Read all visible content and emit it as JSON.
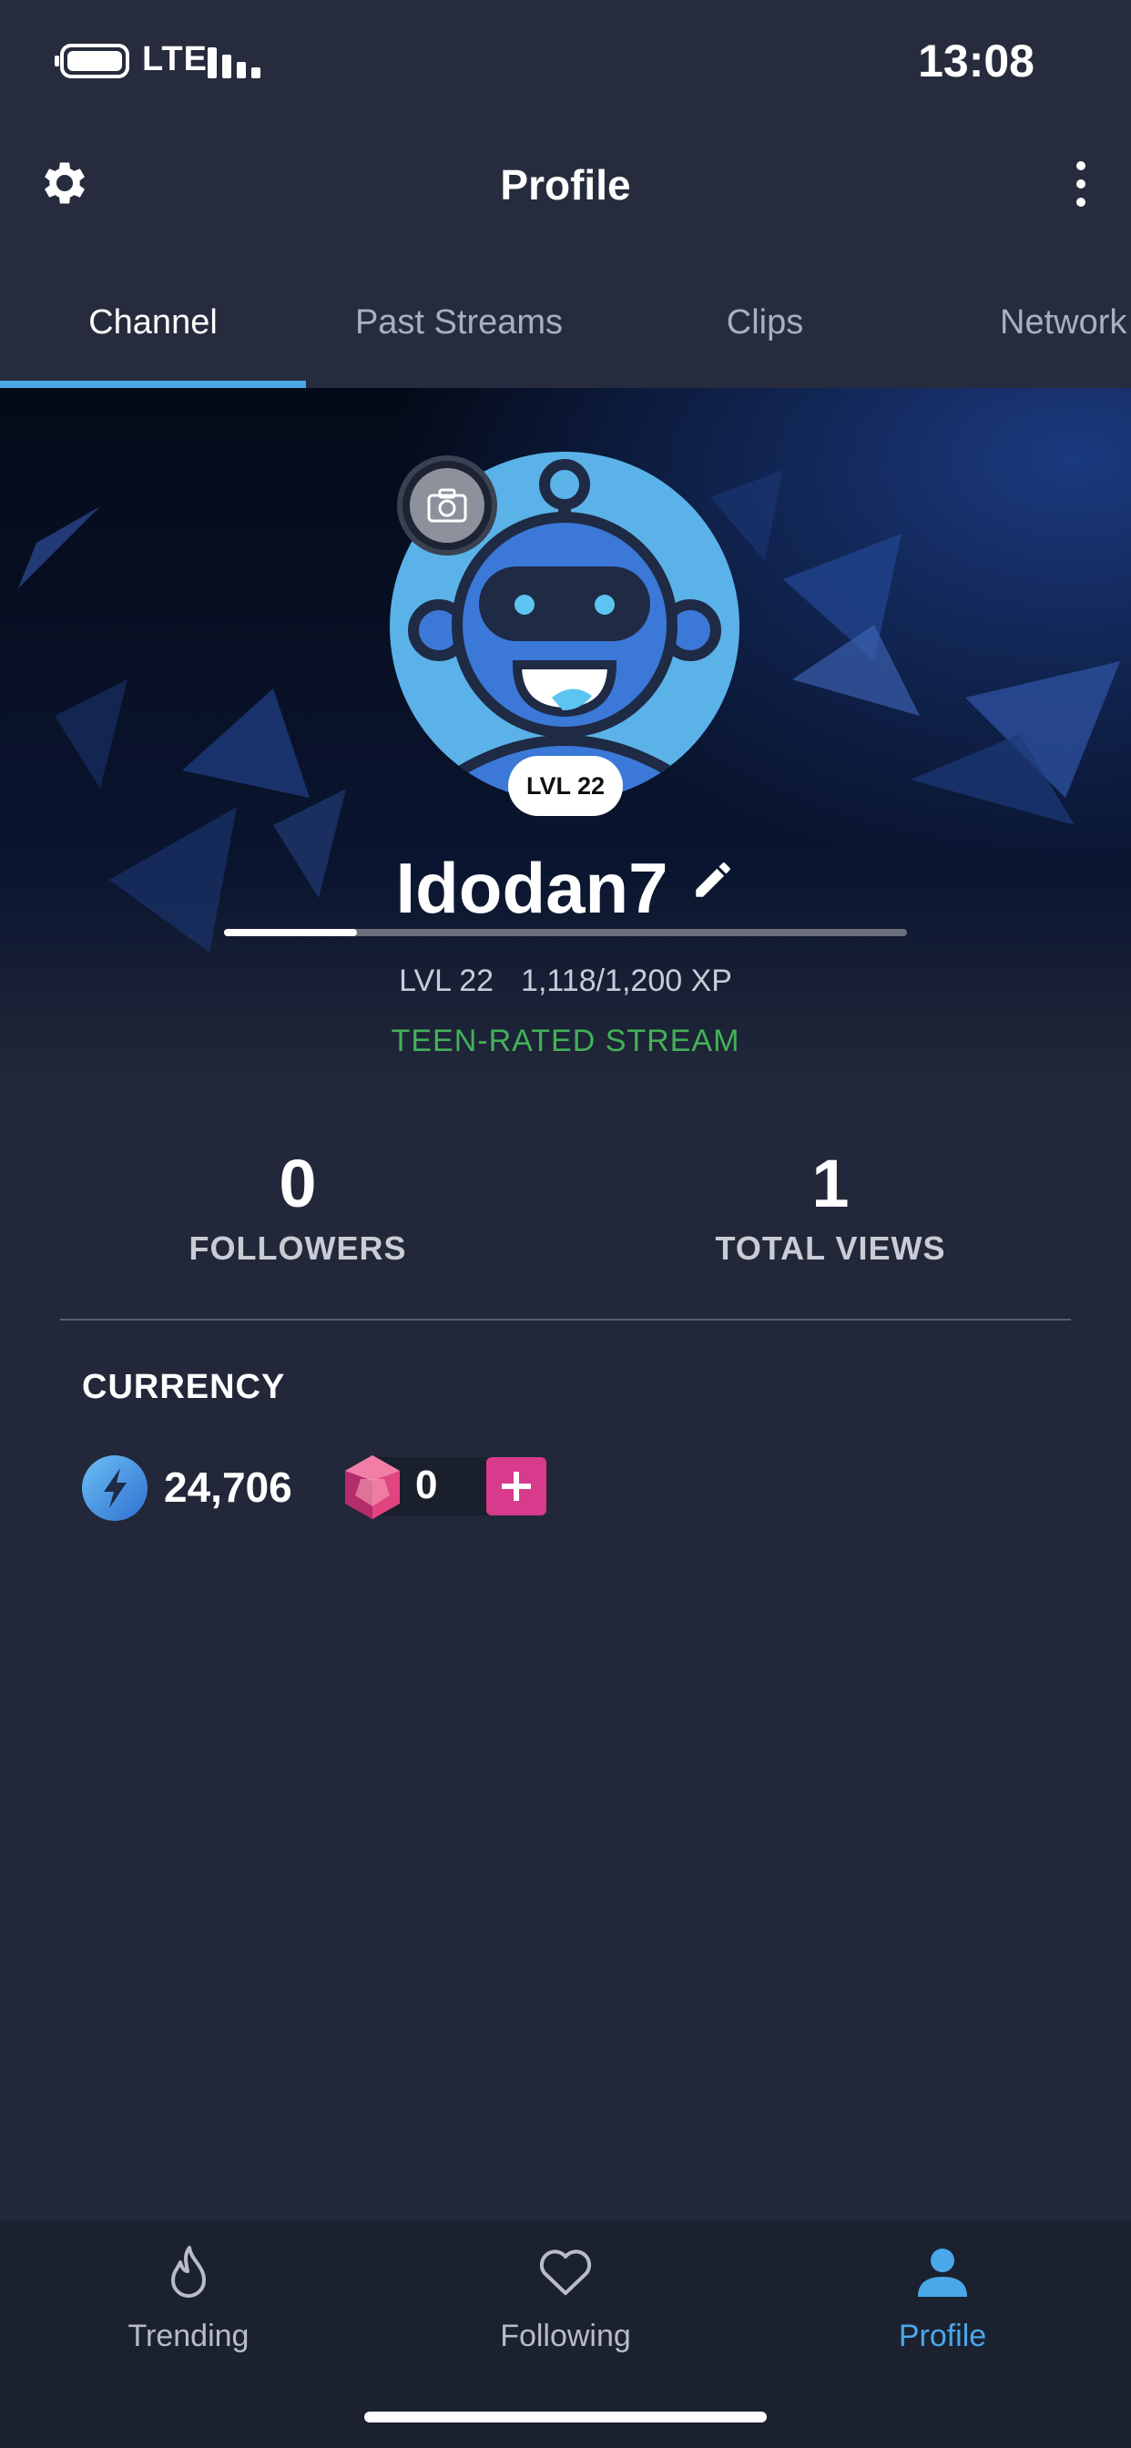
{
  "status_bar": {
    "network": "LTE",
    "time": "13:08"
  },
  "header": {
    "title": "Profile"
  },
  "tabs": [
    {
      "label": "Channel",
      "active": true
    },
    {
      "label": "Past Streams",
      "active": false
    },
    {
      "label": "Clips",
      "active": false
    },
    {
      "label": "Network",
      "active": false
    }
  ],
  "profile": {
    "level_badge": "LVL 22",
    "username": "Idodan7",
    "level": "LVL 22",
    "xp": "1,118/1,200 XP",
    "xp_progress": 0.195,
    "rating": "TEEN-RATED STREAM"
  },
  "stats": {
    "followers_value": "0",
    "followers_label": "FOLLOWERS",
    "views_value": "1",
    "views_label": "TOTAL VIEWS"
  },
  "currency": {
    "title": "CURRENCY",
    "sparks": "24,706",
    "gems": "0"
  },
  "bottom_nav": [
    {
      "label": "Trending",
      "icon": "flame-icon",
      "active": false
    },
    {
      "label": "Following",
      "icon": "heart-icon",
      "active": false
    },
    {
      "label": "Profile",
      "icon": "person-icon",
      "active": true
    }
  ],
  "colors": {
    "accent": "#4aa8e8",
    "rating_green": "#44b158",
    "gem_add": "#d83a8c",
    "background": "#222839"
  }
}
